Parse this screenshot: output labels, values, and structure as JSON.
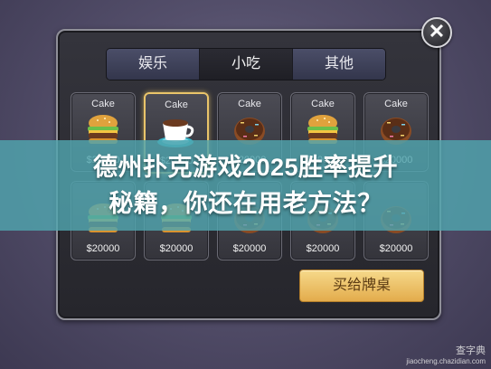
{
  "close": {
    "symbol": "✕"
  },
  "tabs": [
    {
      "label": "娱乐",
      "active": false
    },
    {
      "label": "小吃",
      "active": true
    },
    {
      "label": "其他",
      "active": false
    }
  ],
  "items": [
    {
      "label": "Cake",
      "price": "$20000",
      "icon": "burger-icon"
    },
    {
      "label": "Cake",
      "price": "$20000",
      "icon": "coffee-cup-icon",
      "selected": true
    },
    {
      "label": "Cake",
      "price": "$20000",
      "icon": "donut-icon"
    },
    {
      "label": "Cake",
      "price": "$20000",
      "icon": "burger-icon"
    },
    {
      "label": "Cake",
      "price": "$20000",
      "icon": "donut-icon"
    },
    {
      "label": "",
      "price": "$20000",
      "icon": "burger-icon"
    },
    {
      "label": "",
      "price": "$20000",
      "icon": "burger-icon"
    },
    {
      "label": "",
      "price": "$20000",
      "icon": "donut-icon"
    },
    {
      "label": "",
      "price": "$20000",
      "icon": "donut-icon"
    },
    {
      "label": "",
      "price": "$20000",
      "icon": "donut-icon"
    }
  ],
  "buy_button": "买给牌桌",
  "headline": {
    "line1": "德州扑克游戏2025胜率提升",
    "line2": "秘籍，你还在用老方法？"
  },
  "watermark": {
    "line1": "查字典",
    "line2": "jiaocheng.chazidian.com"
  },
  "colors": {
    "accent": "#e9c46a",
    "banner": "#50a5af",
    "button": "#e3ac4c"
  }
}
